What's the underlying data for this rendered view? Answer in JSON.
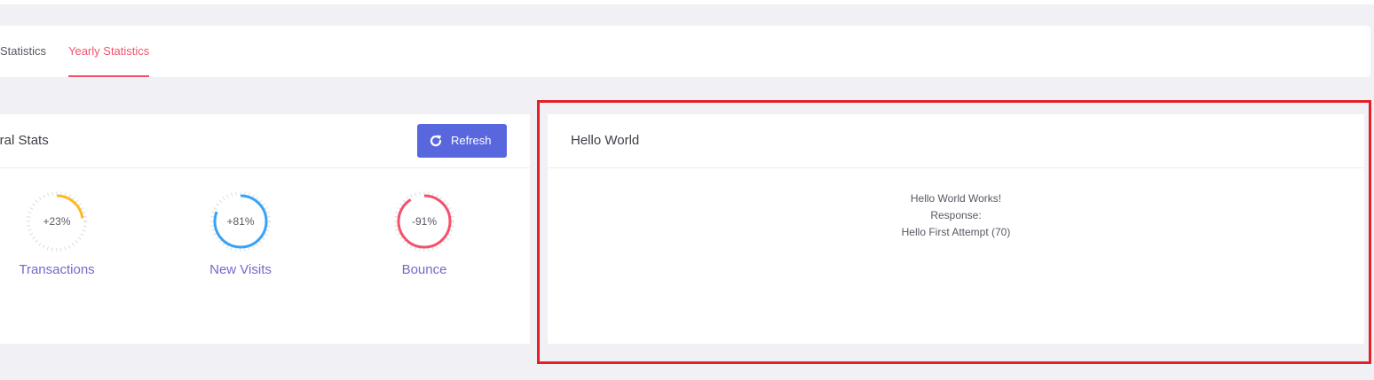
{
  "tabs": [
    {
      "label": "Statistics",
      "active": false
    },
    {
      "label": "Yearly Statistics",
      "active": true
    }
  ],
  "stats_card": {
    "title": "neral Stats",
    "refresh_label": "Refresh",
    "items": [
      {
        "label": "Transactions",
        "value_text": "+23%",
        "percent": 23,
        "color": "#ffb822"
      },
      {
        "label": "New Visits",
        "value_text": "+81%",
        "percent": 81,
        "color": "#36a3f7"
      },
      {
        "label": "Bounce",
        "value_text": "-91%",
        "percent": 91,
        "color": "#f4516c"
      }
    ]
  },
  "hello_card": {
    "title": "Hello World",
    "lines": [
      "Hello World Works!",
      "Response:",
      "Hello First Attempt (70)"
    ]
  },
  "colors": {
    "accent": "#5867dd",
    "active_tab": "#f4516c",
    "highlight_border": "#e3202a"
  }
}
